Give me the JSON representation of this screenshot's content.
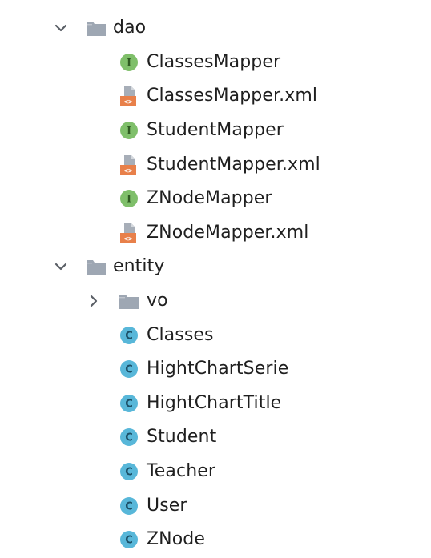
{
  "tree": {
    "rows": [
      {
        "label": "dao",
        "icon": "folder-icon",
        "expanded": true,
        "level": 0
      },
      {
        "label": "ClassesMapper",
        "icon": "interface-icon",
        "level": 1
      },
      {
        "label": "ClassesMapper.xml",
        "icon": "xml-file-icon",
        "level": 1
      },
      {
        "label": "StudentMapper",
        "icon": "interface-icon",
        "level": 1
      },
      {
        "label": "StudentMapper.xml",
        "icon": "xml-file-icon",
        "level": 1
      },
      {
        "label": "ZNodeMapper",
        "icon": "interface-icon",
        "level": 1
      },
      {
        "label": "ZNodeMapper.xml",
        "icon": "xml-file-icon",
        "level": 1
      },
      {
        "label": "entity",
        "icon": "folder-icon",
        "expanded": true,
        "level": 0
      },
      {
        "label": "vo",
        "icon": "folder-icon",
        "expanded": false,
        "level": 1
      },
      {
        "label": "Classes",
        "icon": "class-icon",
        "level": 1
      },
      {
        "label": "HightChartSerie",
        "icon": "class-icon",
        "level": 1
      },
      {
        "label": "HightChartTitle",
        "icon": "class-icon",
        "level": 1
      },
      {
        "label": "Student",
        "icon": "class-icon",
        "level": 1
      },
      {
        "label": "Teacher",
        "icon": "class-icon",
        "level": 1
      },
      {
        "label": "User",
        "icon": "class-icon",
        "level": 1
      },
      {
        "label": "ZNode",
        "icon": "class-icon",
        "level": 1
      }
    ]
  },
  "icons": {
    "interface_letter": "I",
    "class_letter": "C",
    "xml_glyph": "<>"
  },
  "colors": {
    "folder": "#9ea7b3",
    "interface": "#7fbf6a",
    "class": "#58b7d9",
    "xml": "#e8804a",
    "xml_page": "#a7aeb8",
    "chevron": "#5a5f66",
    "text": "#1f1f1f"
  }
}
